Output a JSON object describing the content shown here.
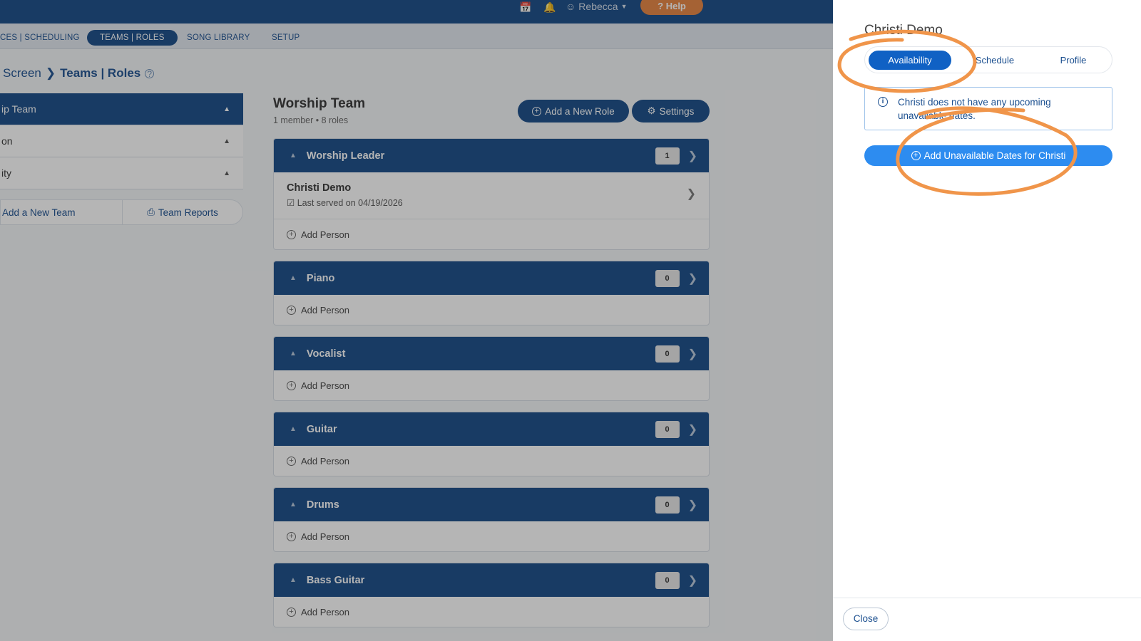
{
  "topbar": {
    "calendar_icon": "calendar-icon",
    "bell_icon": "bell-icon",
    "user_name": "Rebecca",
    "help_label": "Help"
  },
  "nav": {
    "items": [
      "CES | SCHEDULING",
      "TEAMS | ROLES",
      "SONG LIBRARY",
      "SETUP"
    ],
    "active": "TEAMS | ROLES"
  },
  "breadcrumb": {
    "part1": "Screen",
    "part2": "Teams | Roles"
  },
  "left_panel": {
    "rows": [
      "ip Team",
      "on",
      "ity"
    ],
    "add_team": "Add a New Team",
    "reports": "Team Reports"
  },
  "team": {
    "title": "Worship Team",
    "subtitle": "1 member • 8 roles",
    "add_role": "Add a New Role",
    "settings": "Settings"
  },
  "roles": [
    {
      "name": "Worship Leader",
      "count": "1",
      "member": {
        "name": "Christi Demo",
        "last_served": "Last served on 04/19/2026"
      }
    },
    {
      "name": "Piano",
      "count": "0"
    },
    {
      "name": "Vocalist",
      "count": "0"
    },
    {
      "name": "Guitar",
      "count": "0"
    },
    {
      "name": "Drums",
      "count": "0"
    },
    {
      "name": "Bass Guitar",
      "count": "0"
    }
  ],
  "add_person_label": "Add Person",
  "drawer": {
    "title": "Christi Demo",
    "tabs": [
      "Availability",
      "Schedule",
      "Profile"
    ],
    "notice": "Christi does not have any upcoming unavailable dates.",
    "add_unavailable": "Add Unavailable Dates for Christi",
    "close": "Close"
  },
  "colors": {
    "brand_navy": "#164a86",
    "accent_blue": "#2d8cf0",
    "help_orange": "#e8843f",
    "annotation_orange": "#f0954a"
  }
}
